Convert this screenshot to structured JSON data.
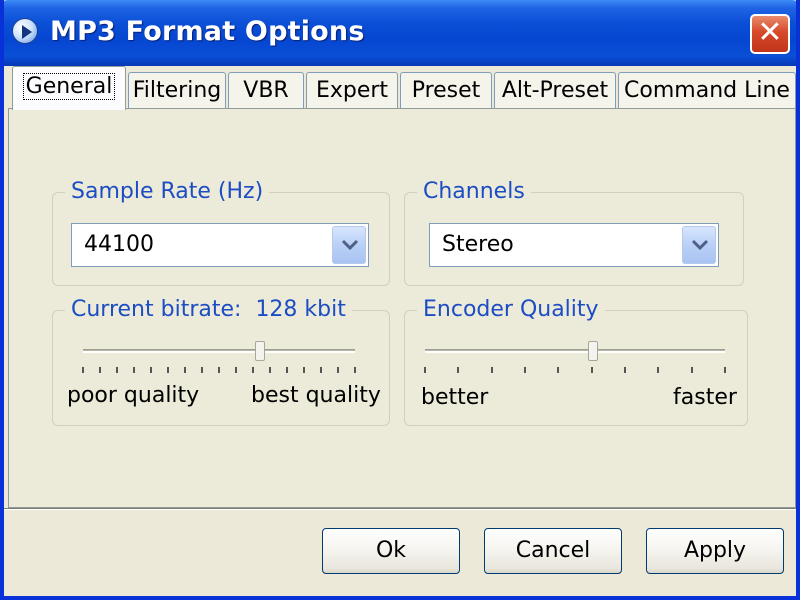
{
  "window": {
    "title": "MP3 Format Options",
    "close_glyph": "✕"
  },
  "tabs": [
    {
      "label": "General",
      "active": true
    },
    {
      "label": "Filtering",
      "active": false
    },
    {
      "label": "VBR",
      "active": false
    },
    {
      "label": "Expert",
      "active": false
    },
    {
      "label": "Preset",
      "active": false
    },
    {
      "label": "Alt-Preset",
      "active": false
    },
    {
      "label": "Command Line",
      "active": false
    }
  ],
  "sample_rate": {
    "label": "Sample Rate (Hz)",
    "value": "44100"
  },
  "channels": {
    "label": "Channels",
    "value": "Stereo"
  },
  "bitrate": {
    "label_prefix": "Current bitrate:",
    "value": "128 kbit",
    "left_caption": "poor quality",
    "right_caption": "best quality",
    "level": 0.65
  },
  "quality": {
    "label": "Encoder Quality",
    "left_caption": "better",
    "right_caption": "faster",
    "level": 0.56
  },
  "buttons": {
    "ok": "Ok",
    "cancel": "Cancel",
    "apply": "Apply"
  },
  "colors": {
    "group_label": "#1d4dc4",
    "titlebar": "#0646d1",
    "close": "#c2341a"
  },
  "icons": {
    "app": "play-icon",
    "dropdown": "chevron-down-icon",
    "close": "close-icon"
  }
}
